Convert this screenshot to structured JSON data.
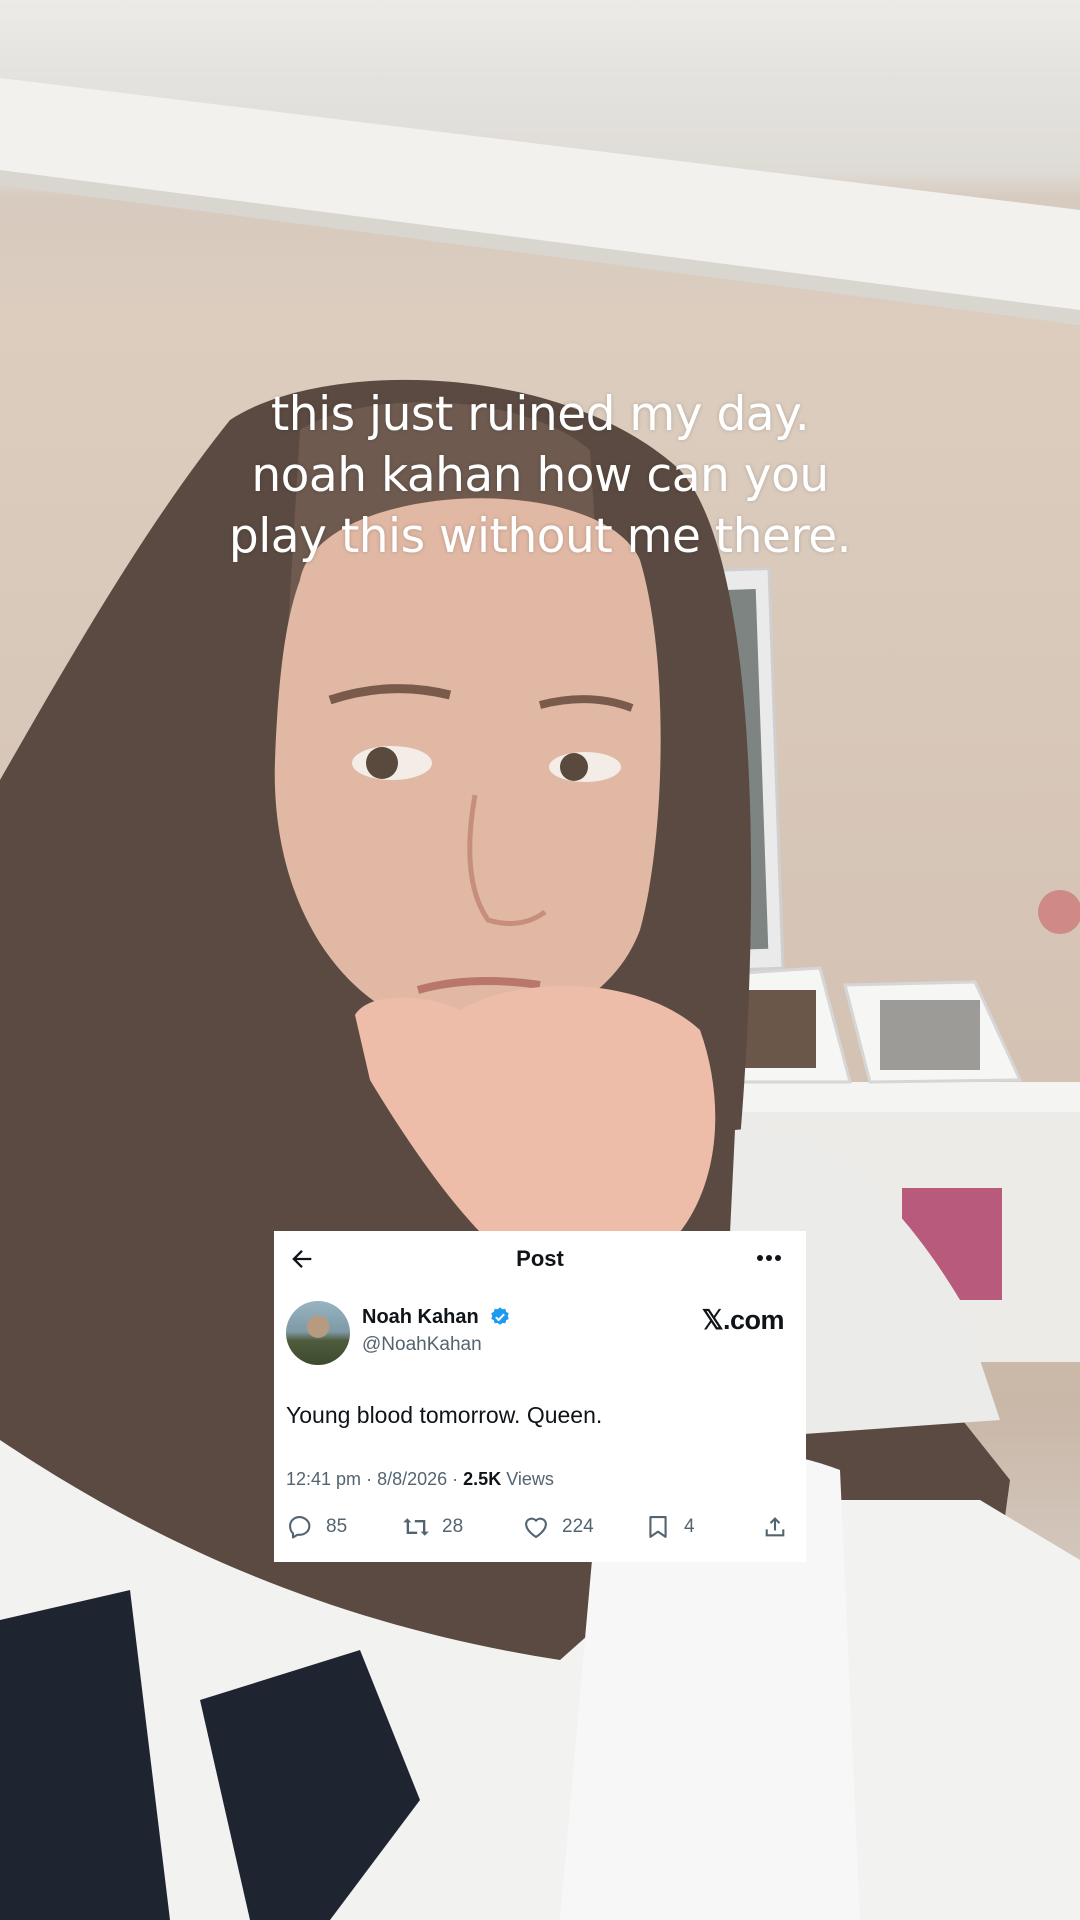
{
  "caption": {
    "lines": [
      "this just ruined my day.",
      "noah kahan how can you",
      "play this without me there."
    ]
  },
  "tweet": {
    "header_title": "Post",
    "author_name": "Noah Kahan",
    "author_handle": "@NoahKahan",
    "brand": "𝕏.com",
    "text": "Young blood tomorrow. Queen.",
    "time": "12:41 pm",
    "date": "8/8/2026",
    "views_count": "2.5K",
    "views_label": "Views",
    "replies": "85",
    "reposts": "28",
    "likes": "224",
    "bookmarks": "4",
    "verified_color": "#1d9bf0"
  },
  "icons": {
    "back": "arrow-left-icon",
    "more": "more-dots-icon",
    "verified": "verified-badge-icon",
    "reply": "reply-bubble-icon",
    "repost": "repost-icon",
    "like": "heart-icon",
    "bookmark": "bookmark-icon",
    "share": "share-upload-icon"
  }
}
